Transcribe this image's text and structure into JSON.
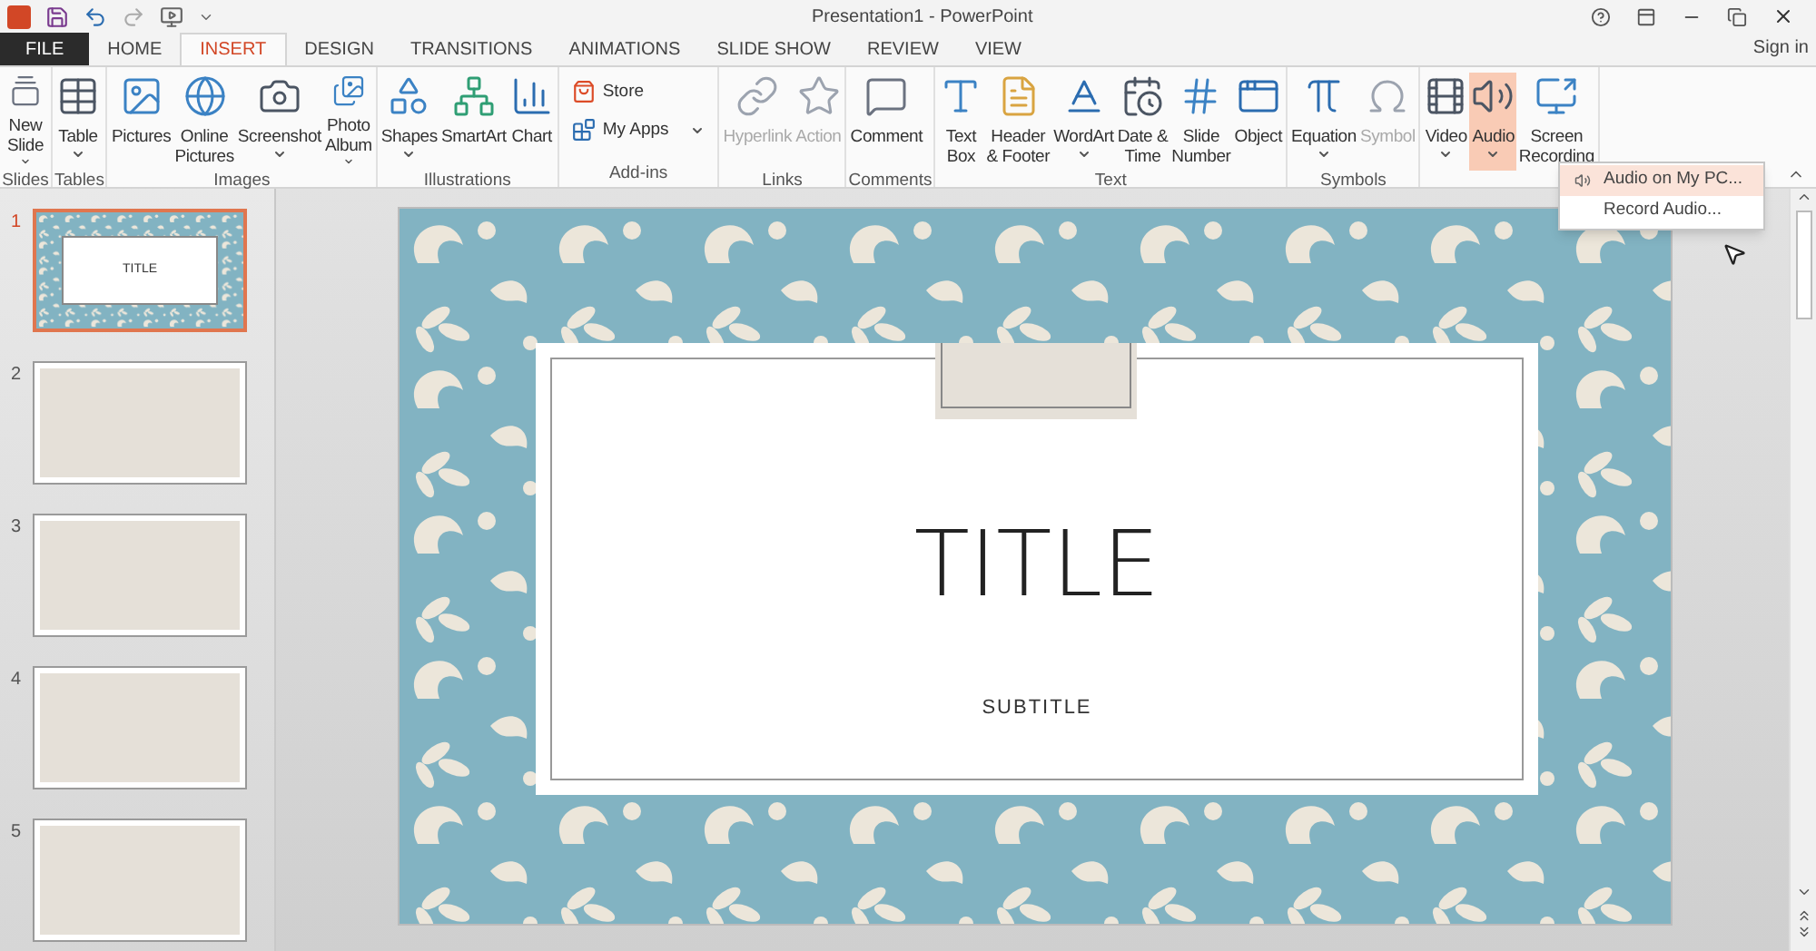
{
  "window": {
    "title": "Presentation1 - PowerPoint",
    "sign_in": "Sign in"
  },
  "tabs": [
    {
      "label": "FILE",
      "kind": "file",
      "selected": false
    },
    {
      "label": "HOME",
      "kind": "tab",
      "selected": false
    },
    {
      "label": "INSERT",
      "kind": "tab",
      "selected": true
    },
    {
      "label": "DESIGN",
      "kind": "tab",
      "selected": false
    },
    {
      "label": "TRANSITIONS",
      "kind": "tab",
      "selected": false
    },
    {
      "label": "ANIMATIONS",
      "kind": "tab",
      "selected": false
    },
    {
      "label": "SLIDE SHOW",
      "kind": "tab",
      "selected": false
    },
    {
      "label": "REVIEW",
      "kind": "tab",
      "selected": false
    },
    {
      "label": "VIEW",
      "kind": "tab",
      "selected": false
    }
  ],
  "ribbon": [
    {
      "label": "Slides",
      "buttons": [
        {
          "kind": "large",
          "lines": [
            "New",
            "Slide"
          ],
          "dropdown": true,
          "disabled": false,
          "highlighted": false
        }
      ]
    },
    {
      "label": "Tables",
      "buttons": [
        {
          "kind": "large",
          "lines": [
            "Table"
          ],
          "dropdown": true,
          "disabled": false,
          "highlighted": false
        }
      ]
    },
    {
      "label": "Images",
      "buttons": [
        {
          "kind": "large",
          "lines": [
            "Pictures"
          ],
          "dropdown": false,
          "disabled": false,
          "highlighted": false
        },
        {
          "kind": "large",
          "lines": [
            "Online",
            "Pictures"
          ],
          "dropdown": false,
          "disabled": false,
          "highlighted": false
        },
        {
          "kind": "large",
          "lines": [
            "Screenshot"
          ],
          "dropdown": true,
          "disabled": false,
          "highlighted": false
        },
        {
          "kind": "large",
          "lines": [
            "Photo",
            "Album"
          ],
          "dropdown": true,
          "disabled": false,
          "highlighted": false
        }
      ]
    },
    {
      "label": "Illustrations",
      "buttons": [
        {
          "kind": "large",
          "lines": [
            "Shapes"
          ],
          "dropdown": true,
          "disabled": false,
          "highlighted": false
        },
        {
          "kind": "large",
          "lines": [
            "SmartArt"
          ],
          "dropdown": false,
          "disabled": false,
          "highlighted": false
        },
        {
          "kind": "large",
          "lines": [
            "Chart"
          ],
          "dropdown": false,
          "disabled": false,
          "highlighted": false
        }
      ]
    },
    {
      "label": "Add-ins",
      "buttons": [
        {
          "kind": "small",
          "lines": [
            "Store"
          ],
          "dropdown": false,
          "disabled": false,
          "highlighted": false
        },
        {
          "kind": "small",
          "lines": [
            "My Apps"
          ],
          "dropdown": true,
          "disabled": false,
          "highlighted": false
        }
      ]
    },
    {
      "label": "Links",
      "buttons": [
        {
          "kind": "large",
          "lines": [
            "Hyperlink"
          ],
          "dropdown": false,
          "disabled": true,
          "highlighted": false
        },
        {
          "kind": "large",
          "lines": [
            "Action"
          ],
          "dropdown": false,
          "disabled": true,
          "highlighted": false
        }
      ]
    },
    {
      "label": "Comments",
      "buttons": [
        {
          "kind": "large",
          "lines": [
            "Comment"
          ],
          "dropdown": false,
          "disabled": false,
          "highlighted": false
        }
      ]
    },
    {
      "label": "Text",
      "buttons": [
        {
          "kind": "large",
          "lines": [
            "Text",
            "Box"
          ],
          "dropdown": false,
          "disabled": false,
          "highlighted": false
        },
        {
          "kind": "large",
          "lines": [
            "Header",
            "& Footer"
          ],
          "dropdown": false,
          "disabled": false,
          "highlighted": false
        },
        {
          "kind": "large",
          "lines": [
            "WordArt"
          ],
          "dropdown": true,
          "disabled": false,
          "highlighted": false
        },
        {
          "kind": "large",
          "lines": [
            "Date &",
            "Time"
          ],
          "dropdown": false,
          "disabled": false,
          "highlighted": false
        },
        {
          "kind": "large",
          "lines": [
            "Slide",
            "Number"
          ],
          "dropdown": false,
          "disabled": false,
          "highlighted": false
        },
        {
          "kind": "large",
          "lines": [
            "Object"
          ],
          "dropdown": false,
          "disabled": false,
          "highlighted": false
        }
      ]
    },
    {
      "label": "Symbols",
      "buttons": [
        {
          "kind": "large",
          "lines": [
            "Equation"
          ],
          "dropdown": true,
          "disabled": false,
          "highlighted": false
        },
        {
          "kind": "large",
          "lines": [
            "Symbol"
          ],
          "dropdown": false,
          "disabled": true,
          "highlighted": false
        }
      ]
    },
    {
      "buttons": [
        {
          "kind": "large",
          "lines": [
            "Video"
          ],
          "dropdown": true,
          "disabled": false,
          "highlighted": false
        },
        {
          "kind": "large",
          "lines": [
            "Audio"
          ],
          "dropdown": true,
          "disabled": false,
          "highlighted": true
        },
        {
          "kind": "large",
          "lines": [
            "Screen",
            "Recording"
          ],
          "dropdown": false,
          "disabled": false,
          "highlighted": false
        }
      ]
    }
  ],
  "audio_menu": [
    {
      "label": "Audio on My PC...",
      "selected": true
    },
    {
      "label": "Record Audio...",
      "selected": false
    }
  ],
  "slides": [
    {
      "number": "1",
      "kind": "title",
      "selected": true,
      "title": "TITLE"
    },
    {
      "number": "2",
      "kind": "blank",
      "selected": false
    },
    {
      "number": "3",
      "kind": "blank",
      "selected": false
    },
    {
      "number": "4",
      "kind": "blank",
      "selected": false
    },
    {
      "number": "5",
      "kind": "blank",
      "selected": false
    }
  ],
  "current_slide": {
    "title": "TITLE",
    "subtitle": "SUBTITLE"
  }
}
